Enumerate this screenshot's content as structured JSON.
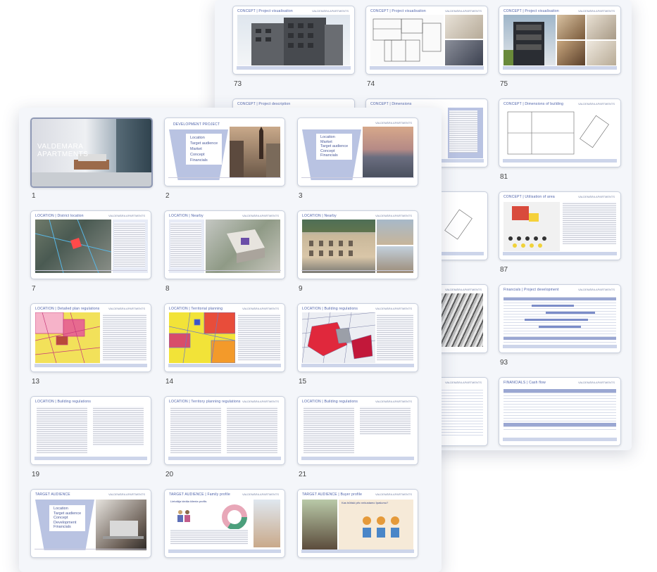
{
  "brand": "VALDEMĀRA APARTMENTS",
  "back_slides": [
    {
      "num": "73",
      "title": "CONCEPT | Project visualisation"
    },
    {
      "num": "74",
      "title": "CONCEPT | Project visualisation"
    },
    {
      "num": "75",
      "title": "CONCEPT | Project visualisation"
    },
    {
      "num": "",
      "title": "CONCEPT | Project description"
    },
    {
      "num": "",
      "title": "CONCEPT | Dimensions"
    },
    {
      "num": "81",
      "title": "CONCEPT | Dimensions of building"
    },
    {
      "num": "87",
      "title": "CONCEPT | Utilisation of area"
    },
    {
      "num": "93",
      "title": "Financials | Project development"
    },
    {
      "num": "",
      "title": "FINANCIALS | Cash flow"
    }
  ],
  "front_slides": [
    {
      "num": "1",
      "title": "VALDEMARA APARTMENTS"
    },
    {
      "num": "2",
      "title": "DEVELOPMENT PROJECT"
    },
    {
      "num": "3",
      "title": "LOCATION"
    },
    {
      "num": "7",
      "title": "LOCATION | District location"
    },
    {
      "num": "8",
      "title": "LOCATION | Nearby"
    },
    {
      "num": "9",
      "title": "LOCATION | Nearby"
    },
    {
      "num": "13",
      "title": "LOCATION | Detailed plan regulations"
    },
    {
      "num": "14",
      "title": "LOCATION | Territorial planning"
    },
    {
      "num": "15",
      "title": "LOCATION | Building regulations"
    },
    {
      "num": "19",
      "title": "LOCATION | Building regulations"
    },
    {
      "num": "20",
      "title": "LOCATION | Territory planning regulations"
    },
    {
      "num": "21",
      "title": "LOCATION | Building regulations"
    },
    {
      "num": "",
      "title": "TARGET AUDIENCE"
    },
    {
      "num": "",
      "title": "TARGET AUDIENCE | Family profile"
    },
    {
      "num": "",
      "title": "TARGET AUDIENCE | Buyer profile"
    }
  ],
  "menu_dev": [
    "Location",
    "Target audience",
    "Market",
    "Concept",
    "Financials"
  ],
  "menu_loc": [
    "Location",
    "Market",
    "Target audience",
    "Concept",
    "Financials"
  ],
  "menu_ta": [
    "Location",
    "Target audience",
    "Concept",
    "Development",
    "Financials"
  ],
  "slide14_heading": "Lietotāja ideāla klienta profils",
  "slide15_heading": "Kas būtiski pēc nekustamo īpašumu?"
}
